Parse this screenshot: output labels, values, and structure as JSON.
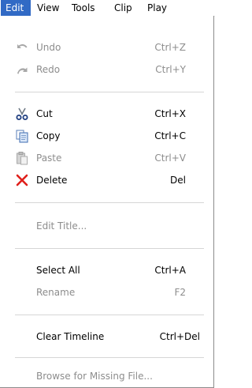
{
  "menubar": {
    "items": [
      {
        "label": "Edit",
        "active": true
      },
      {
        "label": "View"
      },
      {
        "label": "Tools"
      },
      {
        "label": "Clip"
      },
      {
        "label": "Play"
      }
    ]
  },
  "menu": {
    "undo": {
      "label": "Undo",
      "shortcut": "Ctrl+Z",
      "icon": "undo-icon",
      "enabled": false
    },
    "redo": {
      "label": "Redo",
      "shortcut": "Ctrl+Y",
      "icon": "redo-icon",
      "enabled": false
    },
    "cut": {
      "label": "Cut",
      "shortcut": "Ctrl+X",
      "icon": "scissors-icon",
      "enabled": true
    },
    "copy": {
      "label": "Copy",
      "shortcut": "Ctrl+C",
      "icon": "copy-icon",
      "enabled": true
    },
    "paste": {
      "label": "Paste",
      "shortcut": "Ctrl+V",
      "icon": "paste-icon",
      "enabled": false
    },
    "delete": {
      "label": "Delete",
      "shortcut": "Del",
      "icon": "delete-x-icon",
      "enabled": true
    },
    "edit_title": {
      "label": "Edit Title...",
      "enabled": false
    },
    "select_all": {
      "label": "Select All",
      "shortcut": "Ctrl+A",
      "enabled": true
    },
    "rename": {
      "label": "Rename",
      "shortcut": "F2",
      "enabled": false
    },
    "clear_timeline": {
      "label": "Clear Timeline",
      "shortcut": "Ctrl+Del",
      "enabled": true
    },
    "browse_missing": {
      "label": "Browse for Missing File...",
      "enabled": false
    }
  },
  "colors": {
    "highlight": "#316ac5",
    "disabled_text": "#8d8d8d",
    "delete_red": "#e0201c"
  }
}
